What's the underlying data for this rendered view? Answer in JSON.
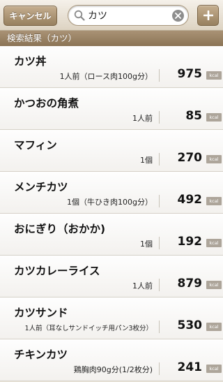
{
  "navbar": {
    "cancel_label": "キャンセル",
    "search_value": "カツ",
    "add_label": "+"
  },
  "section_title": "検索結果（カツ）",
  "unit": "kcal",
  "items": [
    {
      "name": "カツ丼",
      "portion": "1人前（ロース肉100g分）",
      "kcal": "975"
    },
    {
      "name": "かつおの角煮",
      "portion": "1人前",
      "kcal": "85"
    },
    {
      "name": "マフィン",
      "portion": "1個",
      "kcal": "270"
    },
    {
      "name": "メンチカツ",
      "portion": "1個（牛ひき肉100g分）",
      "kcal": "492"
    },
    {
      "name": "おにぎり（おかか)",
      "portion": "1個",
      "kcal": "192"
    },
    {
      "name": "カツカレーライス",
      "portion": "1人前",
      "kcal": "879"
    },
    {
      "name": "カツサンド",
      "portion": "1人前（耳なしサンドイッチ用パン3枚分）",
      "kcal": "530"
    },
    {
      "name": "チキンカツ",
      "portion": "鶏胸肉90g分(1/2枚分)",
      "kcal": "241"
    }
  ]
}
